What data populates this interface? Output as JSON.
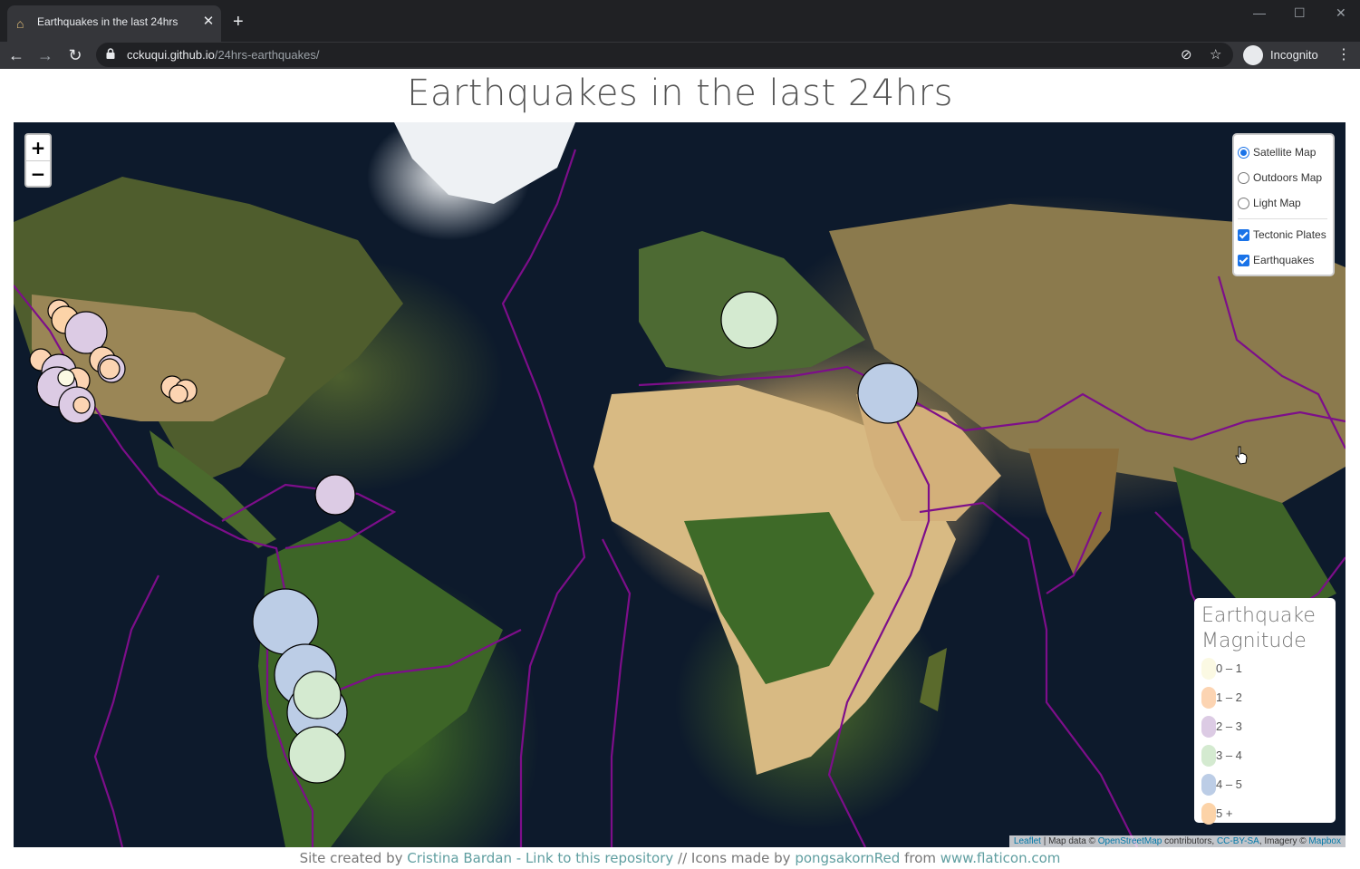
{
  "browser": {
    "tab_title": "Earthquakes in the last 24hrs",
    "url_host": "cckuqui.github.io",
    "url_path": "/24hrs-earthquakes/",
    "profile_label": "Incognito"
  },
  "page": {
    "title": "Earthquakes in the last 24hrs"
  },
  "map": {
    "zoom_in": "+",
    "zoom_out": "−",
    "base_layers": [
      {
        "label": "Satellite Map",
        "selected": true
      },
      {
        "label": "Outdoors Map",
        "selected": false
      },
      {
        "label": "Light Map",
        "selected": false
      }
    ],
    "overlays": [
      {
        "label": "Tectonic Plates",
        "checked": true
      },
      {
        "label": "Earthquakes",
        "checked": true
      }
    ],
    "legend": {
      "title_line1": "Earthquake",
      "title_line2": "Magnitude",
      "items": [
        {
          "label": "0 – 1",
          "color": "#fbf9e3"
        },
        {
          "label": "1 – 2",
          "color": "#fcd4b2"
        },
        {
          "label": "2 – 3",
          "color": "#dccbe4"
        },
        {
          "label": "3 – 4",
          "color": "#d4ead0"
        },
        {
          "label": "4 – 5",
          "color": "#bccde6"
        },
        {
          "label": "5 +",
          "color": "#fcd3a8"
        }
      ]
    },
    "attribution": {
      "leaflet": "Leaflet",
      "sep1": " | Map data © ",
      "osm": "OpenStreetMap",
      "contributors": " contributors, ",
      "license": "CC-BY-SA",
      "imagery": ", Imagery © ",
      "mapbox": "Mapbox"
    },
    "plate_color": "#7d0e8a"
  },
  "footer": {
    "prefix": "Site created by ",
    "author": "Cristina Bardan",
    "dash": " - ",
    "repo_link": "Link to this repository",
    "icons_text": " // Icons made by ",
    "icon_author": "pongsakornRed",
    "from_text": " from ",
    "icon_site": "www.flaticon.com"
  }
}
